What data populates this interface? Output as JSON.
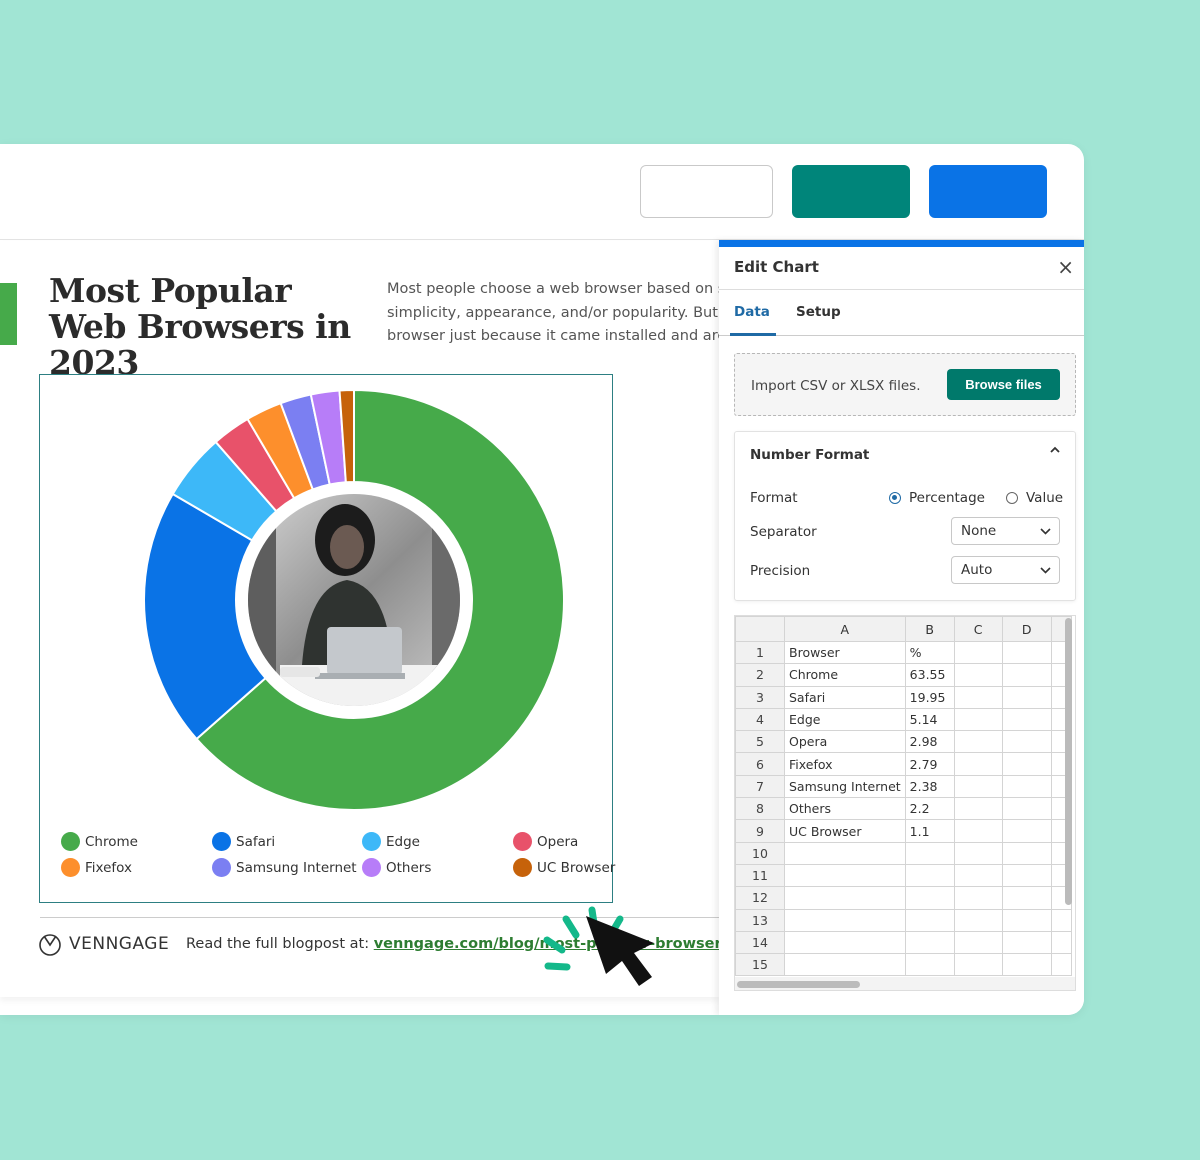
{
  "infographic": {
    "title": "Most Popular Web Browsers in 2023",
    "description_lines": [
      "Most people choose a web browser based on sp",
      "simplicity, appearance, and/or popularity. But sc",
      "browser just because it came installed and are r"
    ]
  },
  "chart_data": {
    "type": "pie",
    "categories": [
      "Chrome",
      "Safari",
      "Edge",
      "Opera",
      "Fixefox",
      "Samsung Internet",
      "Others",
      "UC Browser"
    ],
    "values": [
      63.55,
      19.95,
      5.14,
      2.98,
      2.79,
      2.38,
      2.2,
      1.1
    ],
    "colors": [
      "#46aa4a",
      "#0a73e6",
      "#3db8f8",
      "#e8526a",
      "#fd8f2c",
      "#7b7ff2",
      "#b77df8",
      "#c6620a"
    ],
    "legend_placement": "bottom",
    "style": "donut with center photo"
  },
  "footer": {
    "brand": "VENNGAGE",
    "read_more_prefix": "Read the full blogpost at: ",
    "read_more_link": "venngage.com/blog/most-popular-browsers"
  },
  "panel": {
    "title": "Edit Chart",
    "close": "×",
    "tabs": [
      "Data",
      "Setup"
    ],
    "active_tab": "Data",
    "import_text": "Import CSV or XLSX files.",
    "browse_label": "Browse files",
    "number_format": {
      "title": "Number Format",
      "format_label": "Format",
      "format_options": [
        "Percentage",
        "Value"
      ],
      "format_selected": "Percentage",
      "separator_label": "Separator",
      "separator_value": "None",
      "precision_label": "Precision",
      "precision_value": "Auto"
    },
    "sheet": {
      "columns": [
        "A",
        "B",
        "C",
        "D"
      ],
      "rows": [
        [
          "Browser",
          "%"
        ],
        [
          "Chrome",
          "63.55"
        ],
        [
          "Safari",
          "19.95"
        ],
        [
          "Edge",
          "5.14"
        ],
        [
          "Opera",
          "2.98"
        ],
        [
          "Fixefox",
          "2.79"
        ],
        [
          "Samsung Internet",
          "2.38"
        ],
        [
          "Others",
          "2.2"
        ],
        [
          "UC Browser",
          "1.1"
        ],
        [
          "",
          ""
        ],
        [
          "",
          ""
        ],
        [
          "",
          ""
        ],
        [
          "",
          ""
        ],
        [
          "",
          ""
        ],
        [
          "",
          ""
        ]
      ]
    }
  },
  "icons": {
    "close": "close-icon",
    "chevron_up": "chevron-up-icon",
    "chevron_down": "chevron-down-icon",
    "cursor": "cursor-click-icon",
    "brand": "venngage-logo-icon"
  }
}
